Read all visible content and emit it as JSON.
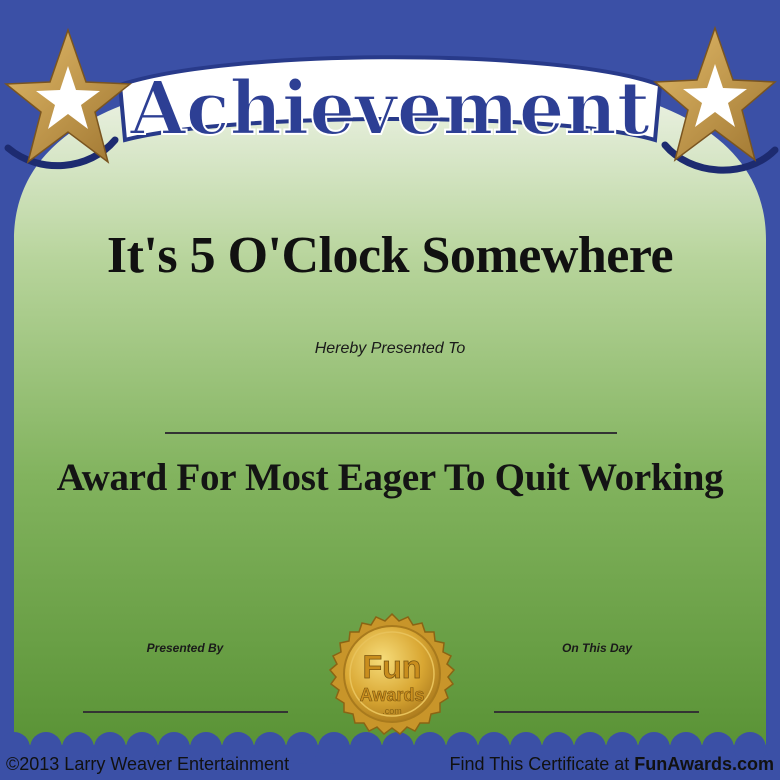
{
  "certificate": {
    "header": "Achievement",
    "subtitle": "It's 5 O'Clock Somewhere",
    "presented_to": "Hereby Presented To",
    "award_title": "Award For Most Eager To Quit Working",
    "presented_by": "Presented By",
    "on_this_day": "On This Day"
  },
  "seal": {
    "line1": "Fun",
    "line2": "Awards",
    "line3": ".com"
  },
  "footer": {
    "copyright": "©2013 Larry Weaver Entertainment",
    "find_prefix": "Find This Certificate at ",
    "find_site": "FunAwards.com"
  },
  "colors": {
    "border_blue": "#3b50a6",
    "green_top": "#eef2e6",
    "green_bottom": "#5f9a3a",
    "gold": "#c89a3a",
    "header_text": "#283a8a"
  }
}
